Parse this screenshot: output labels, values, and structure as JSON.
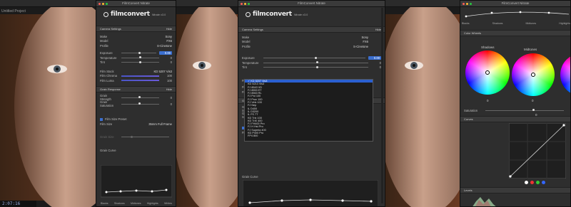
{
  "host": {
    "project_title": "Untitled Project",
    "timecode": "2:07:16"
  },
  "panel_left": {
    "window_title": "FilmConvert Nitrate",
    "logo": "filmconvert",
    "version": "Nitrate v3.0",
    "camera_section": {
      "title": "Camera Settings",
      "action": "Hide"
    },
    "make": {
      "label": "Make",
      "value": "Sony"
    },
    "model": {
      "label": "Model",
      "value": "FX6"
    },
    "profile": {
      "label": "Profile",
      "value": "S-Cinetone"
    },
    "exposure": {
      "label": "Exposure",
      "value": "0.00"
    },
    "temperature": {
      "label": "Temperature",
      "value": "0"
    },
    "tint": {
      "label": "Tint",
      "value": "0"
    },
    "film_stock": {
      "label": "Film Stock",
      "value": "KD 5207 Vis3"
    },
    "film_chroma": {
      "label": "Film Chroma",
      "value": "100"
    },
    "film_luma": {
      "label": "Film Luma",
      "value": "100"
    },
    "grain_section": {
      "title": "Grain Response",
      "action": "Hide"
    },
    "grain_strength": {
      "label": "Grain Strength",
      "value": "0"
    },
    "grain_saturation": {
      "label": "Grain Saturation",
      "value": "0"
    },
    "film_size_preset": {
      "label": "Film Size Preset"
    },
    "film_size": {
      "label": "Film Size",
      "value": "35mm Full Frame"
    },
    "grain_size": {
      "label": "Grain Size"
    },
    "grain_curve": {
      "title": "Grain Curve"
    },
    "curve_labels": [
      "Blacks",
      "Shadows",
      "Midtones",
      "Highlights",
      "Whites"
    ]
  },
  "panel_mid": {
    "window_title": "FilmConvert Nitrate",
    "logo": "filmconvert",
    "version": "Nitrate v3.0",
    "camera_section": {
      "title": "Camera Settings",
      "action": "Hide"
    },
    "make": {
      "label": "Make",
      "value": "Sony"
    },
    "model": {
      "label": "Model",
      "value": "FX6"
    },
    "profile": {
      "label": "Profile",
      "value": "S-Cinetone"
    },
    "exposure": {
      "label": "Exposure",
      "value": "0.00"
    },
    "temperature": {
      "label": "Temperature",
      "value": "0"
    },
    "tint": {
      "label": "Tint",
      "value": "0"
    },
    "film_stock": {
      "label": "Film Stock"
    },
    "film_chroma": {
      "label": "Film Chroma"
    },
    "film_luma": {
      "label": "Film Luma"
    },
    "grain_section": {
      "title": "Grain Respo"
    },
    "grain_strength": {
      "label": "Grain Strength"
    },
    "grain_saturation": {
      "label": "Grain Saturation"
    },
    "film_size_preset": {
      "label": "Film Siz"
    },
    "film_size": {
      "label": "Film Size"
    },
    "grain_curve": {
      "title": "Grain Curve"
    },
    "dropdown_options": [
      "KD 5207 Vis3",
      "KD 5213 Vis3",
      "FJ 8543 VD",
      "FJ 8553 ET",
      "FJ 8563 RL",
      "FJ Pol 100",
      "FJ Prov 100",
      "FJ Velv 100",
      "FJ Nep",
      "IL D400",
      "IL D3200",
      "IL FS 7T",
      "KD Trix 100",
      "KD TriX 400",
      "FJ FH400 Pro",
      "FJ H Hst Pro",
      "FJ Superia 400",
      "KD P400 Pro",
      "FP4 800"
    ],
    "dropdown_selected": "KD 5207 Vis3"
  },
  "panel_right": {
    "window_title": "FilmConvert Nitrate",
    "curve_labels": [
      "Blacks",
      "Shadows",
      "Midtones",
      "Highlights"
    ],
    "color_wheels": {
      "title": "Color Wheels",
      "wheels": [
        {
          "label": "Shadows",
          "value": "0"
        },
        {
          "label": "Midtones",
          "value": "0"
        }
      ]
    },
    "saturation": {
      "label": "Saturation",
      "value": "0"
    },
    "curves": {
      "title": "Curves"
    },
    "levels": {
      "title": "Levels"
    }
  }
}
